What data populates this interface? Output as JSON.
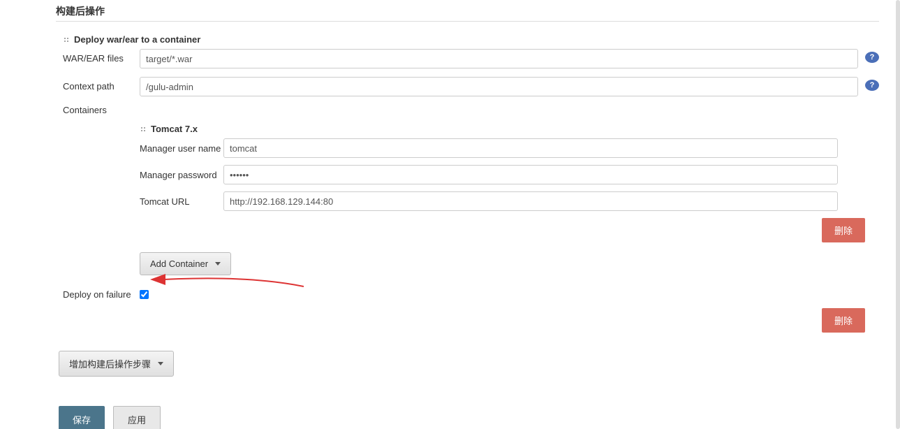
{
  "section": {
    "title": "构建后操作"
  },
  "block": {
    "title": "Deploy war/ear to a container",
    "war_ear_label": "WAR/EAR files",
    "war_ear_value": "target/*.war",
    "context_path_label": "Context path",
    "context_path_value": "/gulu-admin",
    "containers_label": "Containers"
  },
  "container": {
    "title": "Tomcat 7.x",
    "user_label": "Manager user name",
    "user_value": "tomcat",
    "password_label": "Manager password",
    "password_value": "••••••",
    "url_label": "Tomcat URL",
    "url_value": "http://192.168.129.144:80",
    "delete_label": "删除"
  },
  "add_container_label": "Add Container",
  "deploy_on_failure_label": "Deploy on failure",
  "deploy_on_failure_checked": true,
  "outer_delete_label": "删除",
  "add_postbuild_label": "增加构建后操作步骤",
  "buttons": {
    "save": "保存",
    "apply": "应用"
  }
}
